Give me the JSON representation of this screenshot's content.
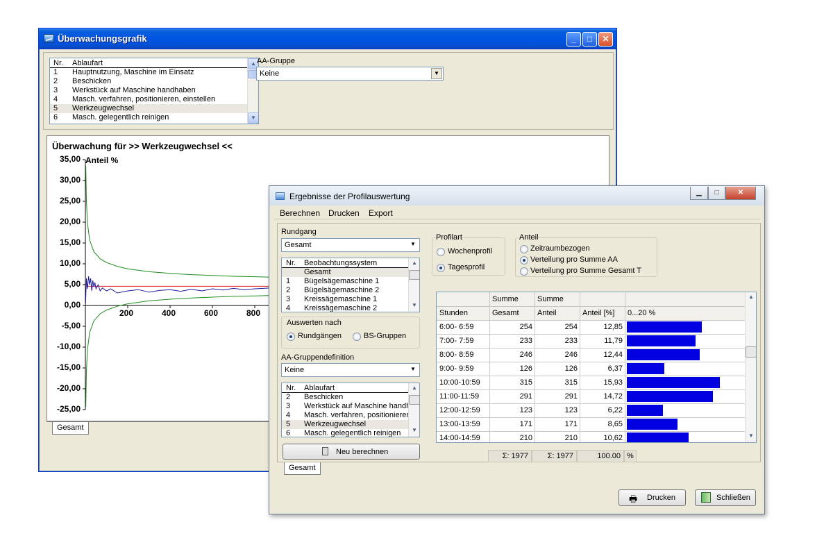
{
  "win1": {
    "title": "Überwachungsgrafik",
    "list": {
      "header_nr": "Nr.",
      "header_name": "Ablaufart",
      "rows": [
        {
          "nr": "1",
          "name": "Hauptnutzung, Maschine im Einsatz"
        },
        {
          "nr": "2",
          "name": "Beschicken"
        },
        {
          "nr": "3",
          "name": "Werkstück auf Maschine handhaben"
        },
        {
          "nr": "4",
          "name": "Masch. verfahren, positionieren, einstellen"
        },
        {
          "nr": "5",
          "name": "Werkzeugwechsel"
        },
        {
          "nr": "6",
          "name": "Masch. gelegentlich reinigen"
        }
      ],
      "selected_index": 4
    },
    "aa_gruppe_label": "AA-Gruppe",
    "aa_gruppe_value": "Keine",
    "chart_title": "Überwachung für >> Werkzeugwechsel <<",
    "tab": "Gesamt"
  },
  "chart_data": {
    "type": "line",
    "title": "Überwachung für >> Werkzeugwechsel <<",
    "ylabel": "Anteil %",
    "xlabel": "",
    "ylim": [
      -25,
      35
    ],
    "y_ticks": [
      "35,00",
      "30,00",
      "25,00",
      "20,00",
      "15,00",
      "10,00",
      "5,00",
      "0,00",
      "-5,00",
      "-10,00",
      "-15,00",
      "-20,00",
      "-25,00"
    ],
    "x_ticks": [
      "200",
      "400",
      "600",
      "800"
    ],
    "x_visible_max": 880,
    "colors": {
      "limits": "#1e8c1e",
      "mean": "#e02020",
      "observed": "#1a1aa0"
    },
    "mean_line": 4.6,
    "series": [
      {
        "role": "upper-limit",
        "x": [
          2,
          5,
          10,
          20,
          40,
          70,
          100,
          150,
          200,
          300,
          400,
          500,
          600,
          700,
          800,
          880
        ],
        "values": [
          33.5,
          25,
          19.8,
          15.7,
          12.9,
          11.2,
          10.3,
          9.4,
          8.8,
          8.1,
          7.7,
          7.4,
          7.2,
          7.0,
          6.9,
          6.8
        ]
      },
      {
        "role": "lower-limit",
        "x": [
          2,
          5,
          10,
          20,
          40,
          70,
          100,
          150,
          200,
          300,
          400,
          500,
          600,
          700,
          800,
          880
        ],
        "values": [
          -24.3,
          -15.8,
          -10.6,
          -6.5,
          -3.7,
          -2.0,
          -1.1,
          -0.2,
          0.4,
          1.1,
          1.5,
          1.8,
          2.0,
          2.2,
          2.3,
          2.4
        ]
      },
      {
        "role": "observed",
        "x": [
          1,
          5,
          10,
          15,
          20,
          25,
          30,
          35,
          40,
          45,
          50,
          60,
          70,
          80,
          100,
          120,
          150,
          200,
          250,
          300,
          350,
          400,
          450,
          500,
          550,
          600,
          650,
          700,
          750,
          800,
          880
        ],
        "values": [
          0.5,
          6.5,
          4.0,
          7.0,
          5.0,
          6.5,
          3.5,
          6.0,
          4.5,
          5.5,
          4.0,
          5.0,
          3.5,
          4.2,
          3.5,
          4.0,
          3.0,
          3.5,
          3.8,
          3.2,
          3.6,
          3.8,
          3.4,
          3.9,
          3.5,
          4.0,
          3.7,
          4.1,
          3.8,
          4.0,
          4.2
        ]
      }
    ],
    "grid": false,
    "legend": "none"
  },
  "win2": {
    "title": "Ergebnisse der Profilauswertung",
    "menu": [
      "Berechnen",
      "Drucken",
      "Export"
    ],
    "rundgang_label": "Rundgang",
    "rundgang_value": "Gesamt",
    "beob_list": {
      "header_nr": "Nr.",
      "header_name": "Beobachtungssystem",
      "rows": [
        {
          "nr": "",
          "name": "Gesamt"
        },
        {
          "nr": "1",
          "name": "Bügelsägemaschine  1"
        },
        {
          "nr": "2",
          "name": "Bügelsägemaschine  2"
        },
        {
          "nr": "3",
          "name": "Kreissägemaschine  1"
        },
        {
          "nr": "4",
          "name": "Kreissägemaschine  2"
        }
      ]
    },
    "auswerten_label": "Auswerten nach",
    "auswerten_options": [
      "Rundgängen",
      "BS-Gruppen"
    ],
    "aa_def_label": "AA-Gruppendefinition",
    "aa_def_value": "Keine",
    "ablauf_list": {
      "header_nr": "Nr.",
      "header_name": "Ablaufart",
      "rows": [
        {
          "nr": "2",
          "name": "Beschicken"
        },
        {
          "nr": "3",
          "name": "Werkstück auf Maschine handh"
        },
        {
          "nr": "4",
          "name": "Masch. verfahren, positionieren,"
        },
        {
          "nr": "5",
          "name": "Werkzeugwechsel"
        },
        {
          "nr": "6",
          "name": "Masch. gelegentlich reinigen"
        }
      ]
    },
    "neu_button": "Neu berechnen",
    "profilart_label": "Profilart",
    "profilart_options": [
      "Wochenprofil",
      "Tagesprofil"
    ],
    "anteil_label": "Anteil",
    "anteil_options": [
      "Zeitraumbezogen",
      "Verteilung pro Summe AA",
      "Verteilung pro Summe Gesamt T"
    ],
    "table": {
      "header_top": [
        "",
        "Summe",
        "Summe",
        "",
        ""
      ],
      "header_bottom": [
        "Stunden",
        "Gesamt",
        "Anteil",
        "Anteil [%]",
        "0...20 %"
      ],
      "bar_max": 20,
      "rows": [
        {
          "hours": "6:00- 6:59",
          "gesamt": "254",
          "anteil": "254",
          "pct": "12,85",
          "bar": 12.85
        },
        {
          "hours": "7:00- 7:59",
          "gesamt": "233",
          "anteil": "233",
          "pct": "11,79",
          "bar": 11.79
        },
        {
          "hours": "8:00- 8:59",
          "gesamt": "246",
          "anteil": "246",
          "pct": "12,44",
          "bar": 12.44
        },
        {
          "hours": "9:00- 9:59",
          "gesamt": "126",
          "anteil": "126",
          "pct": "6,37",
          "bar": 6.37
        },
        {
          "hours": "10:00-10:59",
          "gesamt": "315",
          "anteil": "315",
          "pct": "15,93",
          "bar": 15.93
        },
        {
          "hours": "11:00-11:59",
          "gesamt": "291",
          "anteil": "291",
          "pct": "14,72",
          "bar": 14.72
        },
        {
          "hours": "12:00-12:59",
          "gesamt": "123",
          "anteil": "123",
          "pct": "6,22",
          "bar": 6.22
        },
        {
          "hours": "13:00-13:59",
          "gesamt": "171",
          "anteil": "171",
          "pct": "8,65",
          "bar": 8.65
        },
        {
          "hours": "14:00-14:59",
          "gesamt": "210",
          "anteil": "210",
          "pct": "10,62",
          "bar": 10.62
        }
      ],
      "totals": {
        "gesamt": "Σ: 1977",
        "anteil": "Σ: 1977",
        "pct": "100.00",
        "unit": "%"
      }
    },
    "tab": "Gesamt",
    "drucken_button": "Drucken",
    "schliessen_button": "Schließen"
  }
}
